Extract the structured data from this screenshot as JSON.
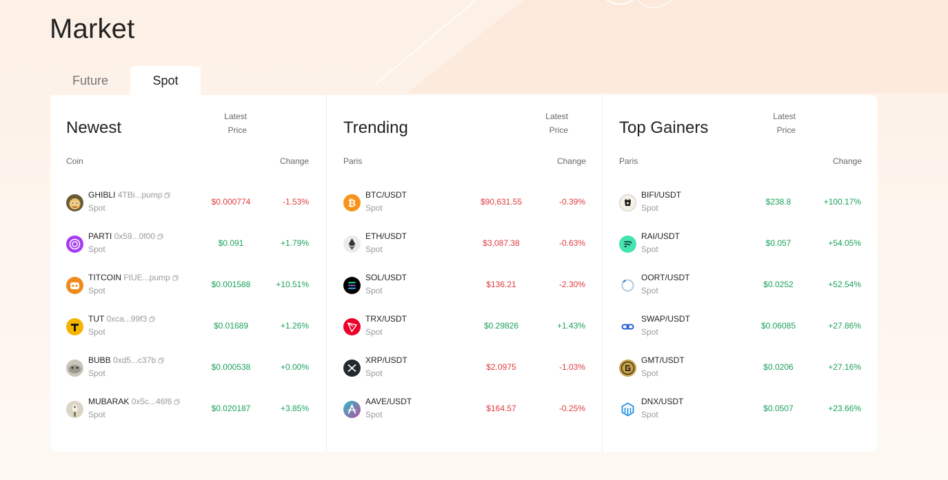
{
  "page_title": "Market",
  "tabs": [
    {
      "label": "Future",
      "active": false
    },
    {
      "label": "Spot",
      "active": true
    }
  ],
  "colors": {
    "up": "#1aa05a",
    "down": "#e03a3e"
  },
  "columns": [
    {
      "title": "Newest",
      "headers": {
        "name": "Coin",
        "price_line1": "Latest",
        "price_line2": "Price",
        "change": "Change"
      },
      "rows": [
        {
          "icon": "ghibli-icon",
          "name": "GHIBLI",
          "address": "4TBi...pump",
          "market": "Spot",
          "price": "$0.000774",
          "change": "-1.53%",
          "trend": "down"
        },
        {
          "icon": "parti-icon",
          "name": "PARTI",
          "address": "0x59...0f00",
          "market": "Spot",
          "price": "$0.091",
          "change": "+1.79%",
          "trend": "up"
        },
        {
          "icon": "titcoin-icon",
          "name": "TITCOIN",
          "address": "FtUE...pump",
          "market": "Spot",
          "price": "$0.001588",
          "change": "+10.51%",
          "trend": "up"
        },
        {
          "icon": "tut-icon",
          "name": "TUT",
          "address": "0xca...99f3",
          "market": "Spot",
          "price": "$0.01689",
          "change": "+1.26%",
          "trend": "up"
        },
        {
          "icon": "bubb-icon",
          "name": "BUBB",
          "address": "0xd5...c37b",
          "market": "Spot",
          "price": "$0.000538",
          "change": "+0.00%",
          "trend": "up"
        },
        {
          "icon": "mubarak-icon",
          "name": "MUBARAK",
          "address": "0x5c...46f6",
          "market": "Spot",
          "price": "$0.020187",
          "change": "+3.85%",
          "trend": "up"
        }
      ]
    },
    {
      "title": "Trending",
      "headers": {
        "name": "Paris",
        "price_line1": "Latest",
        "price_line2": "Price",
        "change": "Change"
      },
      "rows": [
        {
          "icon": "btc-icon",
          "name": "BTC/USDT",
          "market": "Spot",
          "price": "$90,631.55",
          "change": "-0.39%",
          "trend": "down"
        },
        {
          "icon": "eth-icon",
          "name": "ETH/USDT",
          "market": "Spot",
          "price": "$3,087.38",
          "change": "-0.63%",
          "trend": "down"
        },
        {
          "icon": "sol-icon",
          "name": "SOL/USDT",
          "market": "Spot",
          "price": "$136.21",
          "change": "-2.30%",
          "trend": "down"
        },
        {
          "icon": "trx-icon",
          "name": "TRX/USDT",
          "market": "Spot",
          "price": "$0.29826",
          "change": "+1.43%",
          "trend": "up"
        },
        {
          "icon": "xrp-icon",
          "name": "XRP/USDT",
          "market": "Spot",
          "price": "$2.0975",
          "change": "-1.03%",
          "trend": "down"
        },
        {
          "icon": "aave-icon",
          "name": "AAVE/USDT",
          "market": "Spot",
          "price": "$164.57",
          "change": "-0.25%",
          "trend": "down"
        }
      ]
    },
    {
      "title": "Top Gainers",
      "headers": {
        "name": "Paris",
        "price_line1": "Latest",
        "price_line2": "Price",
        "change": "Change"
      },
      "rows": [
        {
          "icon": "bifi-icon",
          "name": "BIFI/USDT",
          "market": "Spot",
          "price": "$238.8",
          "change": "+100.17%",
          "trend": "up"
        },
        {
          "icon": "rai-icon",
          "name": "RAI/USDT",
          "market": "Spot",
          "price": "$0.057",
          "change": "+54.05%",
          "trend": "up"
        },
        {
          "icon": "oort-icon",
          "name": "OORT/USDT",
          "market": "Spot",
          "price": "$0.0252",
          "change": "+52.54%",
          "trend": "up"
        },
        {
          "icon": "swap-icon",
          "name": "SWAP/USDT",
          "market": "Spot",
          "price": "$0.06085",
          "change": "+27.86%",
          "trend": "up"
        },
        {
          "icon": "gmt-icon",
          "name": "GMT/USDT",
          "market": "Spot",
          "price": "$0.0206",
          "change": "+27.16%",
          "trend": "up"
        },
        {
          "icon": "dnx-icon",
          "name": "DNX/USDT",
          "market": "Spot",
          "price": "$0.0507",
          "change": "+23.66%",
          "trend": "up"
        }
      ]
    }
  ]
}
